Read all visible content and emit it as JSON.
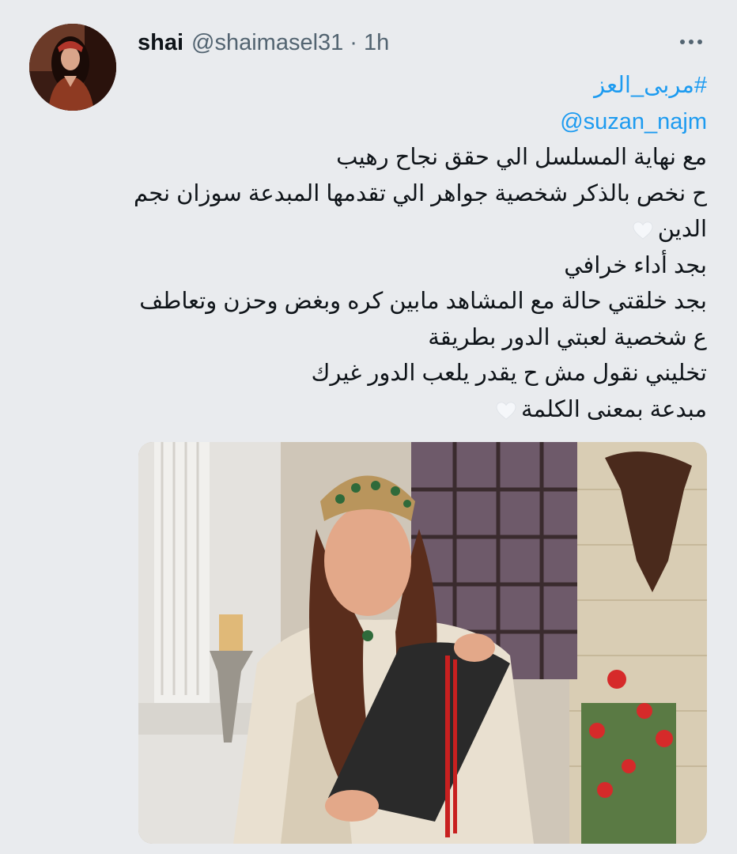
{
  "tweet": {
    "display_name": "shai",
    "handle": "@shaimasel31",
    "separator": "·",
    "time": "1h",
    "hashtag": "#مربى_العز",
    "mention": "@suzan_najm",
    "lines": [
      "مع نهاية المسلسل الي حقق نجاح رهيب",
      "ح نخص بالذكر شخصية جواهر الي تقدمها المبدعة سوزان نجم",
      "الدين",
      "بجد أداء خرافي",
      "بجد خلقتي حالة مع المشاهد مابين كره وبغض وحزن وتعاطف",
      "ع شخصية لعبتي الدور بطريقة",
      "تخليني نقول مش ح يقدر يلعب الدور غيرك",
      "مبدعة بمعنى الكلمة"
    ],
    "icons": {
      "more": "more-horizontal-icon",
      "heart": "white-heart-icon"
    },
    "colors": {
      "link": "#1d9bf0",
      "background": "#e9ebee",
      "secondary_text": "#536471"
    }
  }
}
